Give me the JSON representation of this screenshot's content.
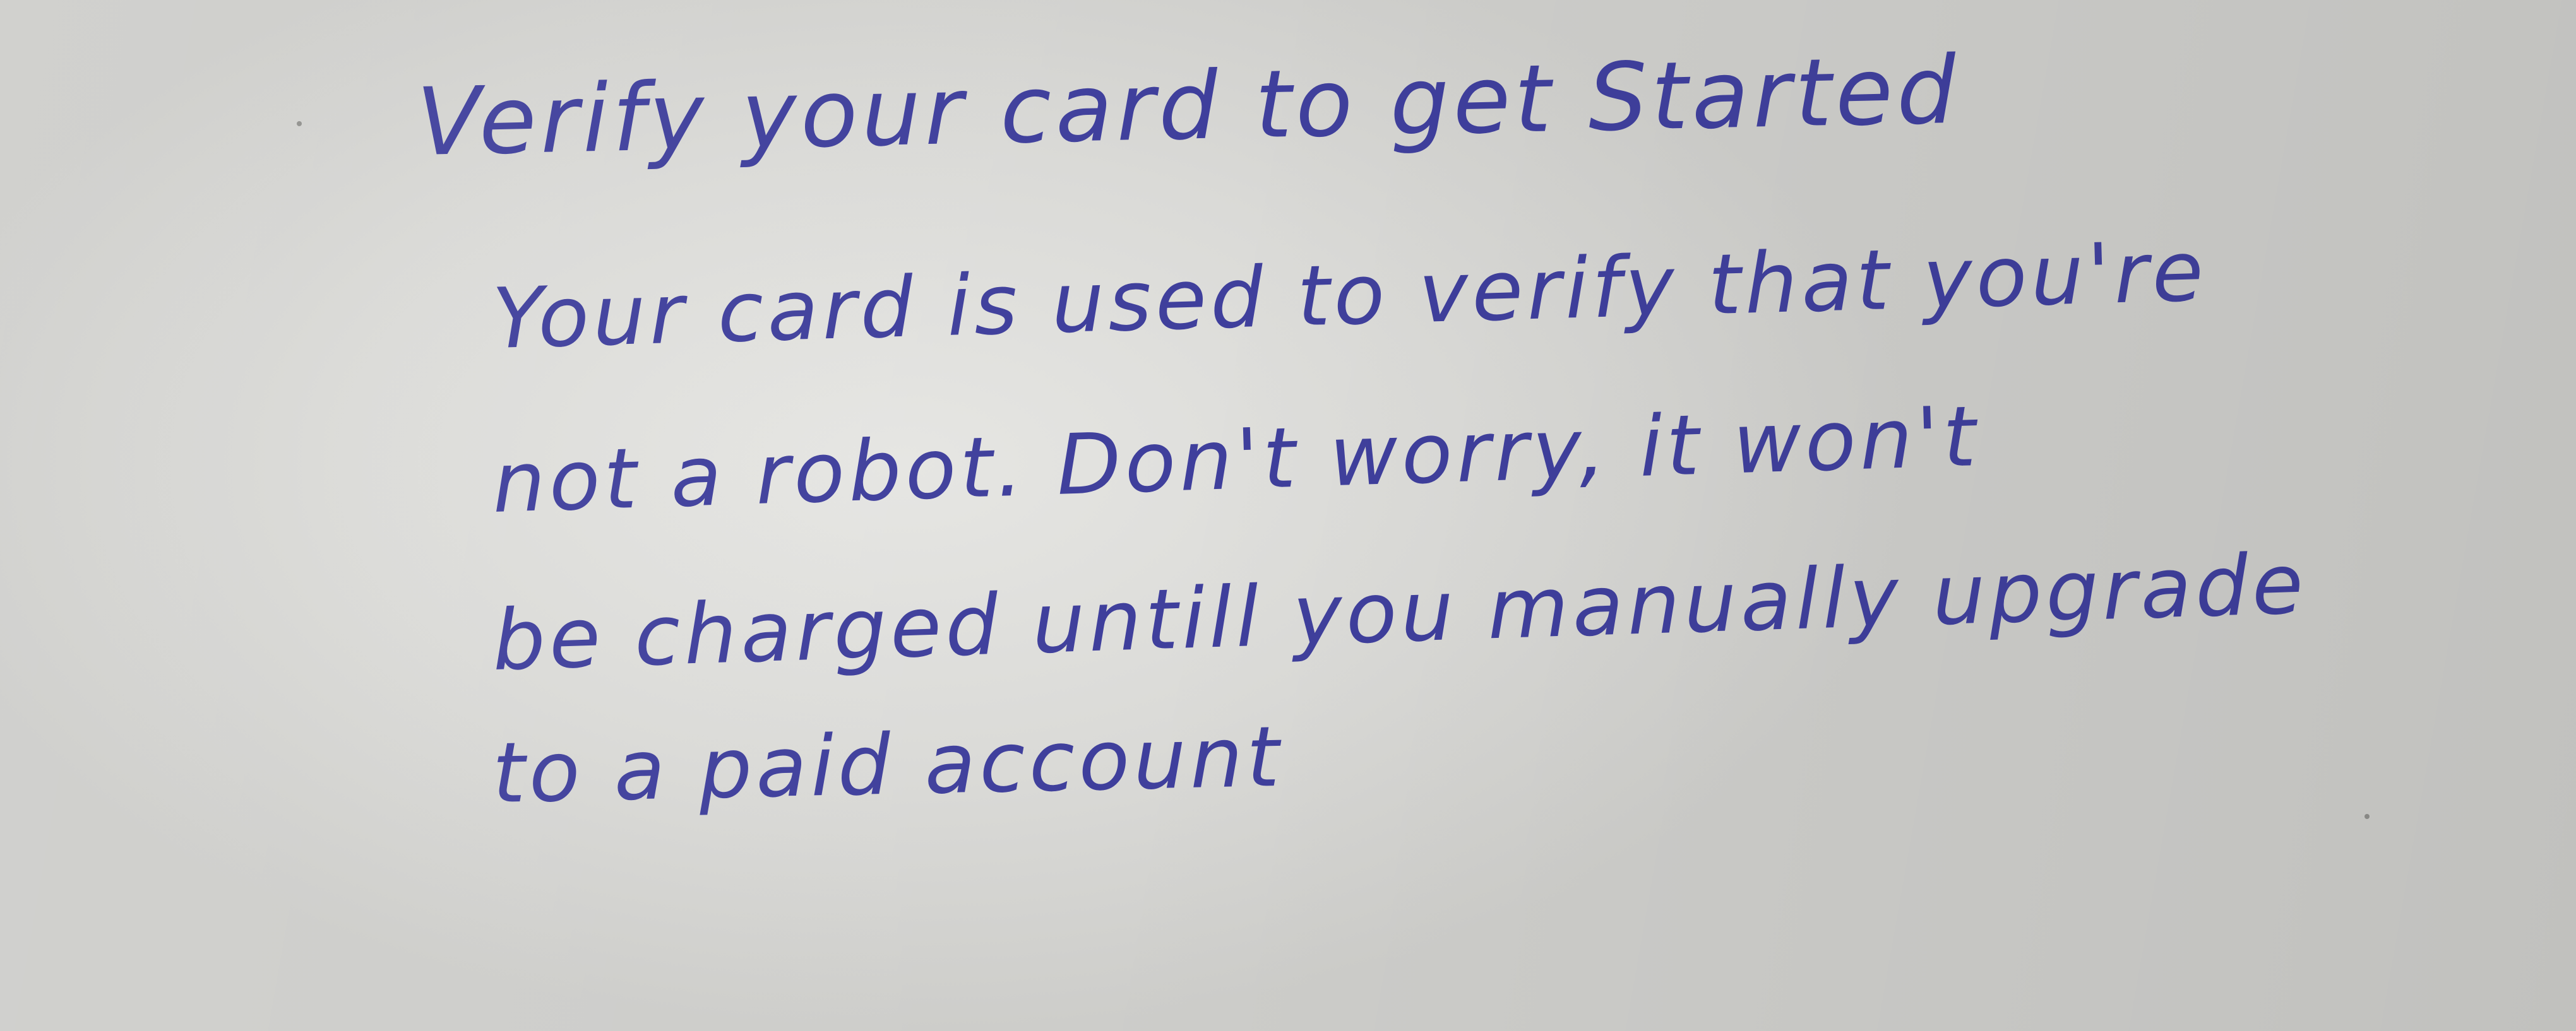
{
  "note": {
    "heading": "Verify your card to get Started",
    "body_lines": [
      "Your card is used to verify that you're",
      "not a robot. Don't worry, it won't",
      "be charged untill you manually upgrade",
      "to a paid account"
    ],
    "ink_color": "#3f3f9c",
    "paper_color": "#dcdcd9"
  }
}
